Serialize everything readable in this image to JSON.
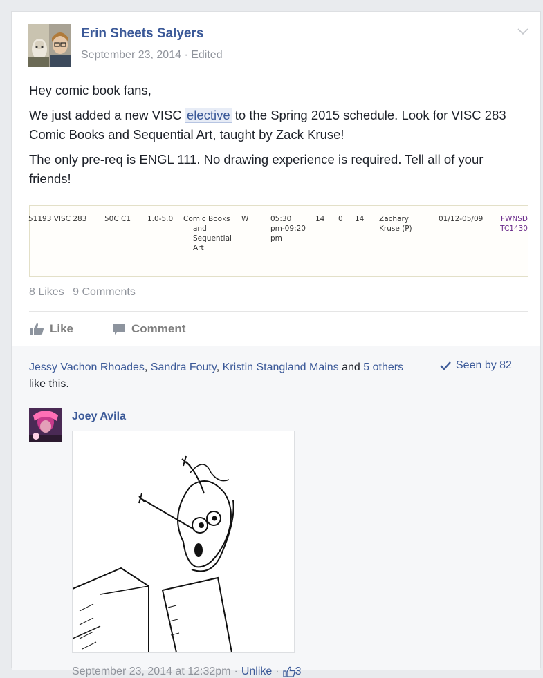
{
  "post": {
    "author": "Erin Sheets Salyers",
    "date": "September 23, 2014",
    "edited": "Edited",
    "meta_separator": "·",
    "greeting": "Hey comic book fans,",
    "para1_before": "We just added a new VISC ",
    "para1_highlight": "elective",
    "para1_after": " to the Spring 2015 schedule. Look for VISC 283 Comic Books and Sequential Art, taught by Zack Kruse!",
    "para2": "The only pre-req is ENGL 111. No drawing experience is required. Tell all of your friends!"
  },
  "schedule": {
    "crn": "51193 VISC 283",
    "section": "50C C1",
    "credits": "1.0-5.0",
    "title_lines": [
      "Comic Books",
      "and",
      "Sequential",
      "Art"
    ],
    "days": "W",
    "time_lines": [
      "05:30",
      "pm-09:20",
      "pm"
    ],
    "cap": "14",
    "act": "0",
    "rem": "14",
    "instructor_lines": [
      "Zachary",
      "Kruse (P)"
    ],
    "dates": "01/12-05/09",
    "location_lines": [
      "FWNSD",
      "TC1430"
    ]
  },
  "stats": {
    "likes": "8 Likes",
    "comments": "9 Comments"
  },
  "actions": {
    "like": "Like",
    "comment": "Comment"
  },
  "likers": {
    "names": [
      "Jessy Vachon Rhoades",
      "Sandra Fouty",
      "Kristin Stangland Mains"
    ],
    "separator": ", ",
    "and": " and ",
    "others": "5 others",
    "suffix": " like this."
  },
  "seen": {
    "label": "Seen by 82"
  },
  "comment": {
    "author": "Joey Avila",
    "timestamp": "September 23, 2014 at 12:32pm",
    "separator": "·",
    "unlike": "Unlike",
    "like_count": "3"
  },
  "colors": {
    "link": "#3b5998",
    "meta": "#90949c",
    "footer_bg": "#f6f7f9",
    "page_bg": "#e9ebee"
  },
  "icons": [
    "chevron-down-icon",
    "thumbs-up-icon",
    "comment-icon",
    "checkmark-icon",
    "like-outline-icon"
  ]
}
